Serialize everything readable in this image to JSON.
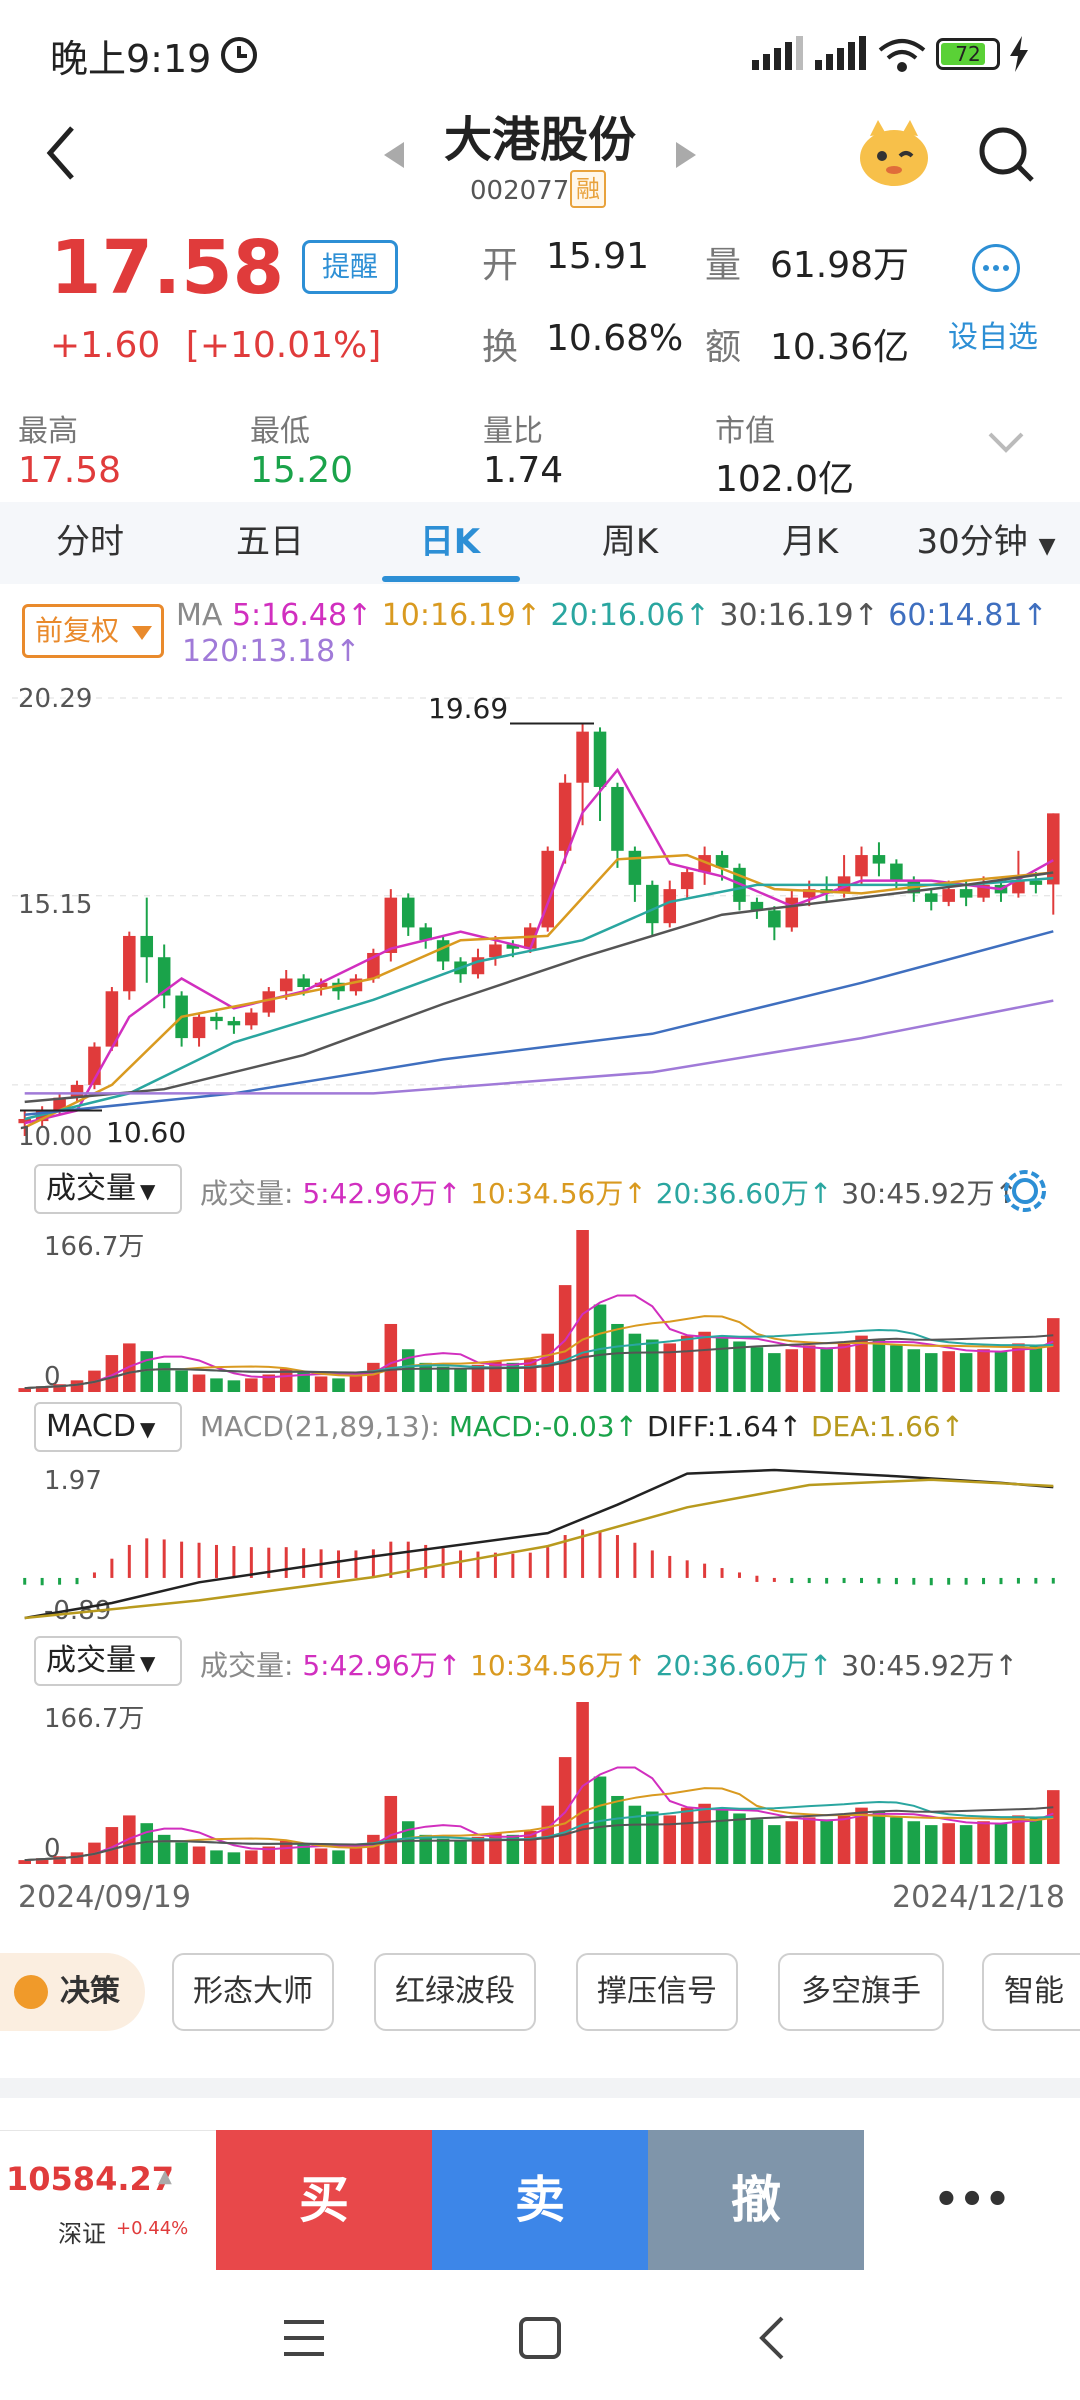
{
  "status": {
    "time": "晚上9:19",
    "battery": "72"
  },
  "header": {
    "name": "大港股份",
    "code": "002077",
    "badge": "融"
  },
  "quote": {
    "price": "17.58",
    "change": "+1.60",
    "change_pct": "[+10.01%]",
    "remind": "提醒",
    "open_label": "开",
    "open": "15.91",
    "vol_label": "量",
    "vol": "61.98万",
    "turnover_label": "换",
    "turnover": "10.68%",
    "amount_label": "额",
    "amount": "10.36亿",
    "watch_label": "设自选"
  },
  "stats": [
    {
      "label": "最高",
      "value": "17.58",
      "color": "#e03b3b"
    },
    {
      "label": "最低",
      "value": "15.20",
      "color": "#1aa34a"
    },
    {
      "label": "量比",
      "value": "1.74",
      "color": "#222222"
    },
    {
      "label": "市值",
      "value": "102.0亿",
      "color": "#222222"
    }
  ],
  "tabs": [
    "分时",
    "五日",
    "日K",
    "周K",
    "月K",
    "30分钟"
  ],
  "ma": {
    "adjust": "前复权",
    "prefix": "MA",
    "items": [
      {
        "text": "5:16.48↑",
        "color": "#d12fbf"
      },
      {
        "text": "10:16.19↑",
        "color": "#d99a20"
      },
      {
        "text": "20:16.06↑",
        "color": "#2aa6a0"
      },
      {
        "text": "30:16.19↑",
        "color": "#555555"
      },
      {
        "text": "60:14.81↑",
        "color": "#3f6fbf"
      }
    ],
    "item120": {
      "text": "120:13.18↑",
      "color": "#a07ad8"
    }
  },
  "main_axis": {
    "top": "20.29",
    "mid": "15.15",
    "bottom": "10.00",
    "high_mark": "19.69",
    "low_mark": "10.60"
  },
  "vol_panel": {
    "button": "成交量",
    "label": "成交量:",
    "items": [
      {
        "text": "5:42.96万↑",
        "color": "#d12fbf"
      },
      {
        "text": "10:34.56万↑",
        "color": "#d99a20"
      },
      {
        "text": "20:36.60万↑",
        "color": "#2aa6a0"
      },
      {
        "text": "30:45.92万↑",
        "color": "#555555"
      }
    ],
    "top": "166.7万",
    "zero": "0"
  },
  "macd_panel": {
    "button": "MACD",
    "label": "MACD(21,89,13):",
    "macd": "MACD:-0.03↑",
    "diff": "DIFF:1.64↑",
    "dea": "DEA:1.66↑",
    "top": "1.97",
    "bottom": "-0.89"
  },
  "dates": {
    "start": "2024/09/19",
    "end": "2024/12/18"
  },
  "strategy": {
    "decide": "决策",
    "chips": [
      "形态大师",
      "红绿波段",
      "撑压信号",
      "多空旗手",
      "智能"
    ]
  },
  "index": {
    "value": "10584.27",
    "name": "深证",
    "pct": "+0.44%"
  },
  "trade": {
    "buy": "买",
    "sell": "卖",
    "cancel": "撤",
    "more": "•••"
  },
  "colors": {
    "up": "#e03b3b",
    "down": "#1aa34a",
    "accent": "#2d8fd5",
    "buy": "#e8484a",
    "sell": "#3d86e8",
    "cancel": "#7f95aa"
  },
  "chart_data": {
    "type": "candlestick",
    "title": "",
    "ylim": [
      10.0,
      20.29
    ],
    "x_range": [
      "2024/09/19",
      "2024/12/18"
    ],
    "candles": [
      [
        10.3,
        10.4,
        10.0,
        10.6
      ],
      [
        10.35,
        10.6,
        10.2,
        10.7
      ],
      [
        10.6,
        10.9,
        10.5,
        11.0
      ],
      [
        10.9,
        11.2,
        10.8,
        11.3
      ],
      [
        11.2,
        12.1,
        11.1,
        12.2
      ],
      [
        12.1,
        13.4,
        12.0,
        13.5
      ],
      [
        13.4,
        14.7,
        13.2,
        14.8
      ],
      [
        14.7,
        14.2,
        13.6,
        15.6
      ],
      [
        14.2,
        13.3,
        13.0,
        14.5
      ],
      [
        13.3,
        12.3,
        12.1,
        13.4
      ],
      [
        12.3,
        12.8,
        12.1,
        12.9
      ],
      [
        12.8,
        12.7,
        12.5,
        12.9
      ],
      [
        12.7,
        12.6,
        12.4,
        12.8
      ],
      [
        12.6,
        12.9,
        12.5,
        13.0
      ],
      [
        12.9,
        13.4,
        12.8,
        13.5
      ],
      [
        13.4,
        13.7,
        13.2,
        13.9
      ],
      [
        13.7,
        13.5,
        13.3,
        13.8
      ],
      [
        13.5,
        13.6,
        13.3,
        13.7
      ],
      [
        13.6,
        13.4,
        13.2,
        13.7
      ],
      [
        13.4,
        13.7,
        13.3,
        13.8
      ],
      [
        13.7,
        14.3,
        13.6,
        14.4
      ],
      [
        14.3,
        15.6,
        14.1,
        15.8
      ],
      [
        15.6,
        14.9,
        14.7,
        15.7
      ],
      [
        14.9,
        14.6,
        14.4,
        15.0
      ],
      [
        14.6,
        14.1,
        13.9,
        14.7
      ],
      [
        14.1,
        13.8,
        13.6,
        14.2
      ],
      [
        13.8,
        14.2,
        13.7,
        14.4
      ],
      [
        14.2,
        14.5,
        14.0,
        14.7
      ],
      [
        14.5,
        14.4,
        14.2,
        14.6
      ],
      [
        14.4,
        14.9,
        14.3,
        15.0
      ],
      [
        14.9,
        16.7,
        14.8,
        16.8
      ],
      [
        16.7,
        18.3,
        16.4,
        18.5
      ],
      [
        18.3,
        19.5,
        17.3,
        19.69
      ],
      [
        19.5,
        18.2,
        17.4,
        19.6
      ],
      [
        18.2,
        16.7,
        16.3,
        18.3
      ],
      [
        16.7,
        15.9,
        15.5,
        16.8
      ],
      [
        15.9,
        15.0,
        14.7,
        16.0
      ],
      [
        15.0,
        15.8,
        14.9,
        16.0
      ],
      [
        15.8,
        16.2,
        15.6,
        16.3
      ],
      [
        16.2,
        16.6,
        15.9,
        16.8
      ],
      [
        16.6,
        16.3,
        16.0,
        16.7
      ],
      [
        16.3,
        15.5,
        15.3,
        16.4
      ],
      [
        15.5,
        15.3,
        15.1,
        15.6
      ],
      [
        15.3,
        14.9,
        14.6,
        15.4
      ],
      [
        14.9,
        15.6,
        14.8,
        15.8
      ],
      [
        15.6,
        15.8,
        15.4,
        16.0
      ],
      [
        15.8,
        15.7,
        15.5,
        16.1
      ],
      [
        15.7,
        16.1,
        15.6,
        16.6
      ],
      [
        16.1,
        16.6,
        15.9,
        16.8
      ],
      [
        16.6,
        16.4,
        16.1,
        16.9
      ],
      [
        16.4,
        16.0,
        15.8,
        16.5
      ],
      [
        16.0,
        15.7,
        15.5,
        16.1
      ],
      [
        15.7,
        15.5,
        15.3,
        15.8
      ],
      [
        15.5,
        15.8,
        15.4,
        16.0
      ],
      [
        15.8,
        15.6,
        15.4,
        16.0
      ],
      [
        15.6,
        15.9,
        15.5,
        16.1
      ],
      [
        15.9,
        15.7,
        15.5,
        16.0
      ],
      [
        15.7,
        16.0,
        15.6,
        16.7
      ],
      [
        16.0,
        15.9,
        15.7,
        16.2
      ],
      [
        15.91,
        17.58,
        15.2,
        17.58
      ]
    ],
    "ma_lines": [
      {
        "name": "MA5",
        "color": "#d12fbf",
        "points": [
          [
            0,
            10.3
          ],
          [
            3,
            10.6
          ],
          [
            6,
            12.8
          ],
          [
            9,
            13.7
          ],
          [
            12,
            13.0
          ],
          [
            16,
            13.4
          ],
          [
            21,
            14.4
          ],
          [
            25,
            14.8
          ],
          [
            29,
            14.4
          ],
          [
            32,
            17.6
          ],
          [
            34,
            18.6
          ],
          [
            37,
            16.4
          ],
          [
            40,
            16.1
          ],
          [
            44,
            15.4
          ],
          [
            48,
            16.0
          ],
          [
            52,
            16.0
          ],
          [
            56,
            15.8
          ],
          [
            59,
            16.48
          ]
        ]
      },
      {
        "name": "MA10",
        "color": "#d99a20",
        "points": [
          [
            0,
            10.2
          ],
          [
            5,
            11.2
          ],
          [
            9,
            12.8
          ],
          [
            14,
            13.2
          ],
          [
            20,
            13.7
          ],
          [
            25,
            14.6
          ],
          [
            30,
            14.7
          ],
          [
            34,
            16.5
          ],
          [
            38,
            16.6
          ],
          [
            43,
            15.8
          ],
          [
            48,
            15.7
          ],
          [
            54,
            16.0
          ],
          [
            59,
            16.19
          ]
        ]
      },
      {
        "name": "MA20",
        "color": "#2aa6a0",
        "points": [
          [
            0,
            10.4
          ],
          [
            6,
            11.0
          ],
          [
            12,
            12.2
          ],
          [
            20,
            13.2
          ],
          [
            26,
            14.1
          ],
          [
            32,
            14.6
          ],
          [
            37,
            15.5
          ],
          [
            42,
            15.9
          ],
          [
            48,
            15.9
          ],
          [
            54,
            15.9
          ],
          [
            59,
            16.06
          ]
        ]
      },
      {
        "name": "MA30",
        "color": "#555555",
        "points": [
          [
            0,
            10.8
          ],
          [
            8,
            11.1
          ],
          [
            16,
            11.9
          ],
          [
            24,
            13.1
          ],
          [
            32,
            14.2
          ],
          [
            40,
            15.2
          ],
          [
            48,
            15.6
          ],
          [
            54,
            15.9
          ],
          [
            59,
            16.19
          ]
        ]
      },
      {
        "name": "MA60",
        "color": "#3f6fbf",
        "points": [
          [
            0,
            10.5
          ],
          [
            12,
            11.0
          ],
          [
            24,
            11.8
          ],
          [
            36,
            12.4
          ],
          [
            48,
            13.6
          ],
          [
            59,
            14.81
          ]
        ]
      },
      {
        "name": "MA120",
        "color": "#a07ad8",
        "points": [
          [
            0,
            11.0
          ],
          [
            20,
            11.0
          ],
          [
            36,
            11.5
          ],
          [
            48,
            12.3
          ],
          [
            59,
            13.18
          ]
        ]
      }
    ],
    "volume_ylim": [
      0,
      166.7
    ],
    "volumes": [
      4,
      6,
      8,
      12,
      22,
      38,
      50,
      42,
      30,
      22,
      18,
      14,
      12,
      14,
      18,
      24,
      20,
      16,
      14,
      18,
      30,
      70,
      44,
      30,
      26,
      24,
      28,
      32,
      30,
      34,
      60,
      110,
      166.7,
      90,
      70,
      60,
      54,
      50,
      58,
      62,
      56,
      52,
      46,
      40,
      44,
      48,
      46,
      52,
      58,
      54,
      48,
      44,
      40,
      42,
      40,
      44,
      42,
      50,
      48,
      76
    ],
    "macd_ylim": [
      -0.89,
      1.97
    ],
    "macd_hist": [
      -0.05,
      -0.06,
      -0.05,
      -0.04,
      0.1,
      0.35,
      0.6,
      0.72,
      0.7,
      0.66,
      0.64,
      0.6,
      0.58,
      0.56,
      0.55,
      0.56,
      0.54,
      0.52,
      0.5,
      0.5,
      0.52,
      0.66,
      0.66,
      0.6,
      0.54,
      0.5,
      0.48,
      0.46,
      0.44,
      0.46,
      0.56,
      0.78,
      0.88,
      0.86,
      0.78,
      0.64,
      0.5,
      0.4,
      0.32,
      0.26,
      0.18,
      0.1,
      0.04,
      0.0,
      -0.02,
      -0.02,
      -0.03,
      -0.02,
      -0.02,
      -0.03,
      -0.04,
      -0.05,
      -0.06,
      -0.05,
      -0.05,
      -0.04,
      -0.04,
      -0.03,
      -0.03,
      -0.03
    ],
    "diff": [
      [
        0,
        -0.89
      ],
      [
        5,
        -0.6
      ],
      [
        10,
        -0.2
      ],
      [
        20,
        0.3
      ],
      [
        30,
        0.75
      ],
      [
        34,
        1.3
      ],
      [
        38,
        1.9
      ],
      [
        43,
        1.97
      ],
      [
        50,
        1.85
      ],
      [
        56,
        1.72
      ],
      [
        59,
        1.64
      ]
    ],
    "dea": [
      [
        0,
        -0.89
      ],
      [
        10,
        -0.55
      ],
      [
        20,
        -0.1
      ],
      [
        30,
        0.5
      ],
      [
        38,
        1.25
      ],
      [
        45,
        1.68
      ],
      [
        52,
        1.78
      ],
      [
        59,
        1.66
      ]
    ]
  }
}
